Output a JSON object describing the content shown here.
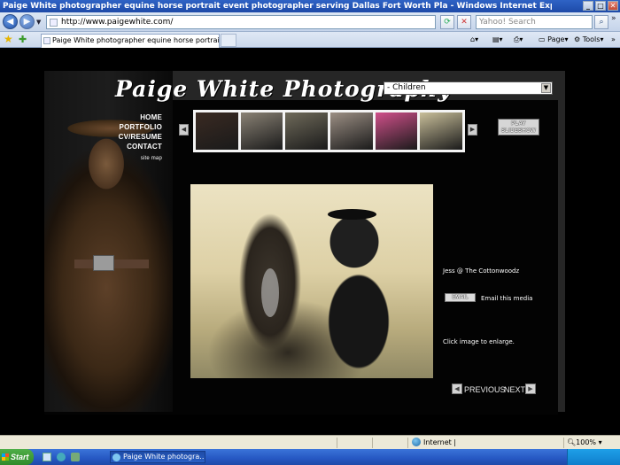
{
  "window": {
    "title": "Paige White photographer equine horse portrait event photographer serving Dallas Fort Worth Pla - Windows Internet Explorer"
  },
  "browser": {
    "address": "http://www.paigewhite.com/",
    "search_placeholder": "Yahoo! Search",
    "tab_title": "Paige White photographer equine horse portrait even...",
    "page_menu": "Page",
    "tools_menu": "Tools",
    "status_zone": "Internet |",
    "zoom": "100%"
  },
  "site": {
    "logo": "Paige White Photography",
    "gallery_select": "- Children",
    "menu": [
      "HOME",
      "PORTFOLIO",
      "CV/RESUME",
      "CONTACT"
    ],
    "site_map": "site map",
    "play_slideshow": "PLAY SLIDESHOW",
    "caption": "Jess @ The Cottonwoodz",
    "email_button": "EMAIL",
    "email_label": "Email this media",
    "enlarge_hint": "Click image to enlarge.",
    "previous": "PREVIOUS",
    "next": "NEXT",
    "thumbnails": [
      {
        "name": "thumb-dark-portrait",
        "color": "#3a2a22"
      },
      {
        "name": "thumb-girl-white-dress",
        "color": "#8a8275"
      },
      {
        "name": "thumb-girl-in-trees",
        "color": "#6f6a5a"
      },
      {
        "name": "thumb-girl-pink-field",
        "color": "#9c8f84"
      },
      {
        "name": "thumb-two-girls-pink",
        "color": "#d0508a"
      },
      {
        "name": "thumb-girl-on-horse",
        "color": "#c9bf9a"
      }
    ]
  },
  "taskbar": {
    "start": "Start",
    "window_item": "Paige White photogra..."
  }
}
